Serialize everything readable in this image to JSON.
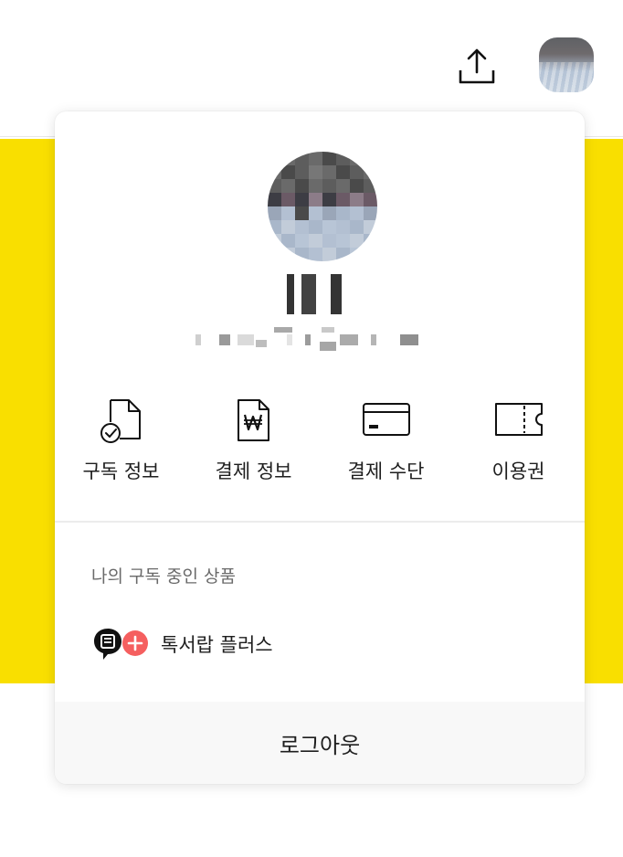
{
  "header": {
    "share_icon": "share-upload-icon",
    "avatar_icon": "user-avatar-photo"
  },
  "popup": {
    "menu": [
      {
        "label": "구독 정보",
        "icon": "subscription-document-check-icon"
      },
      {
        "label": "결제 정보",
        "icon": "payment-receipt-won-icon"
      },
      {
        "label": "결제 수단",
        "icon": "credit-card-icon"
      },
      {
        "label": "이용권",
        "icon": "ticket-pass-icon"
      }
    ],
    "section_title": "나의 구독 중인 상품",
    "product": {
      "label": "톡서랍 플러스",
      "icon": "talk-drawer-plus-icon"
    },
    "logout_label": "로그아웃"
  },
  "colors": {
    "accent_yellow": "#f9df00",
    "plus_badge_red": "#f55f5f",
    "logo_black": "#111111"
  }
}
